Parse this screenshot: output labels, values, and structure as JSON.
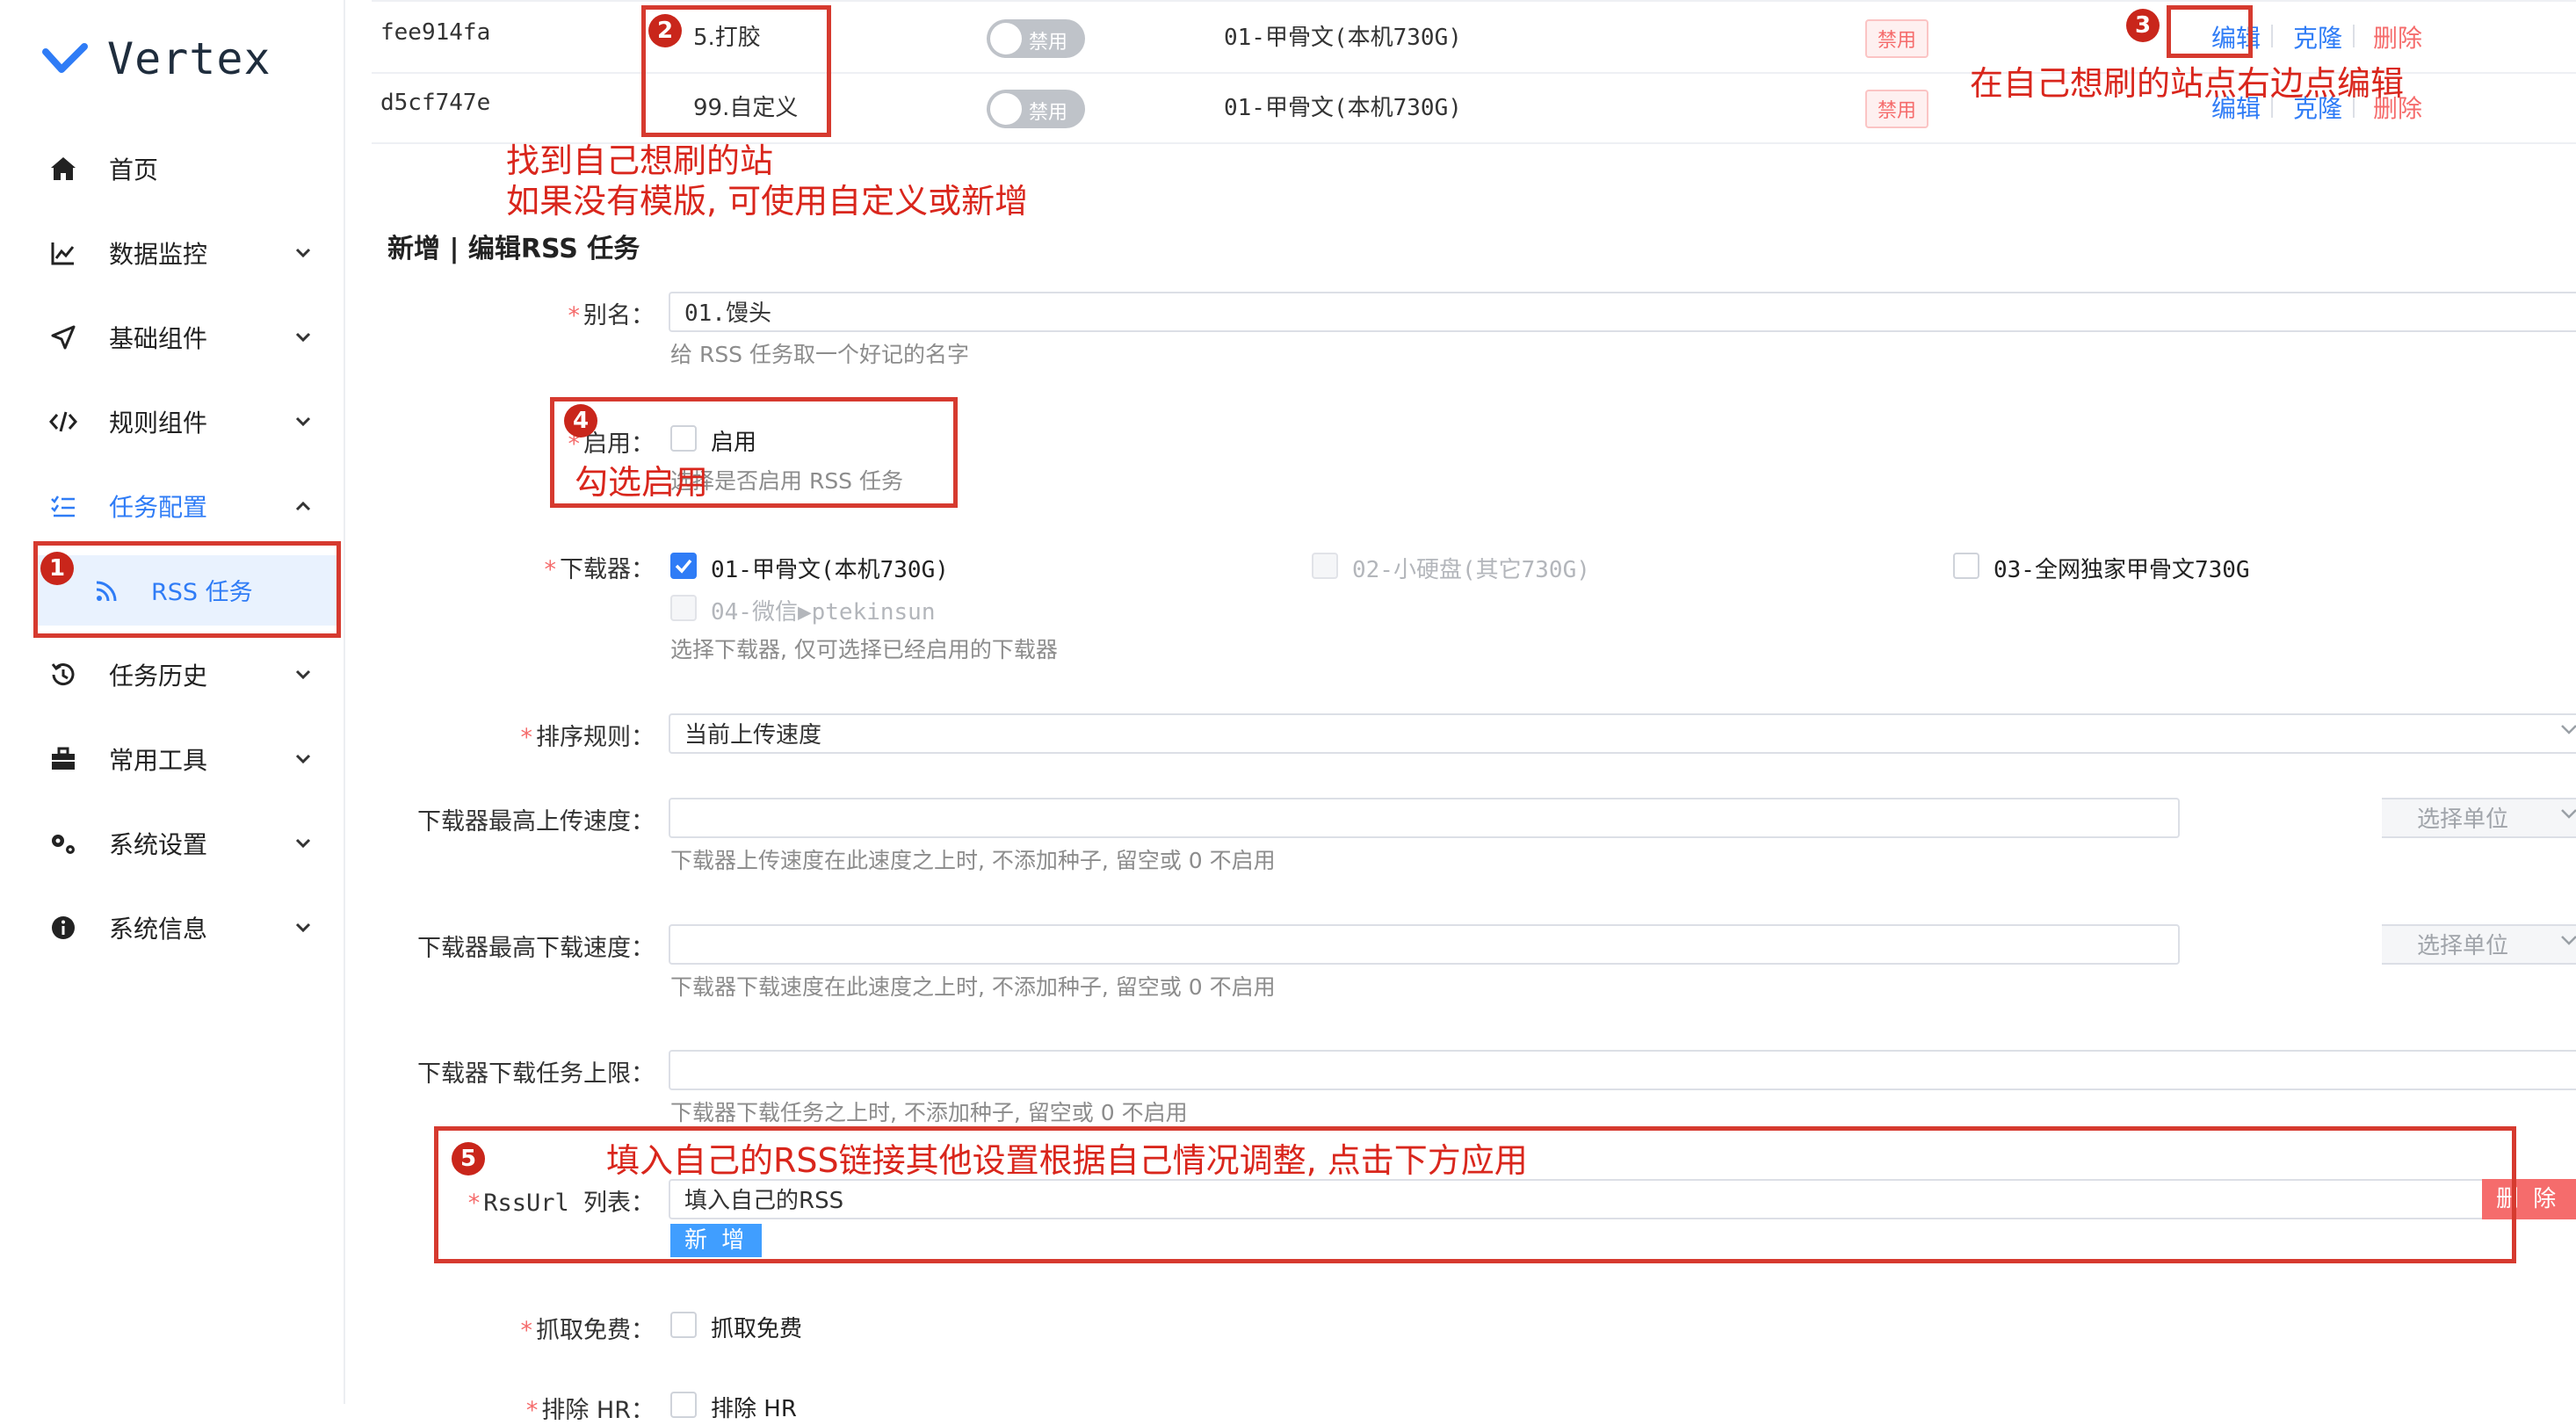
{
  "app": {
    "name": "Vertex"
  },
  "sidebar": {
    "items": [
      {
        "label": "首页",
        "icon": "home-icon"
      },
      {
        "label": "数据监控",
        "icon": "chart-line-icon"
      },
      {
        "label": "基础组件",
        "icon": "send-icon"
      },
      {
        "label": "规则组件",
        "icon": "code-icon"
      },
      {
        "label": "任务配置",
        "icon": "list-check-icon",
        "expanded": true
      },
      {
        "label": "任务历史",
        "icon": "history-icon"
      },
      {
        "label": "常用工具",
        "icon": "toolbox-icon"
      },
      {
        "label": "系统设置",
        "icon": "gears-icon"
      },
      {
        "label": "系统信息",
        "icon": "info-icon"
      }
    ],
    "sub_item": {
      "label": "RSS 任务",
      "icon": "rss-icon"
    }
  },
  "table": {
    "rows": [
      {
        "id": "fee914fa",
        "name": "5.打胶",
        "toggle": "禁用",
        "downloader": "01-甲骨文(本机730G)",
        "status": "禁用"
      },
      {
        "id": "d5cf747e",
        "name": "99.自定义",
        "toggle": "禁用",
        "downloader": "01-甲骨文(本机730G)",
        "status": "禁用"
      }
    ],
    "actions": {
      "edit": "编辑",
      "clone": "克隆",
      "delete": "删除"
    }
  },
  "form": {
    "title": "新增 | 编辑RSS 任务",
    "alias": {
      "label": "别名：",
      "value": "01.馒头",
      "help": "给 RSS 任务取一个好记的名字"
    },
    "enable": {
      "label": "启用：",
      "option": "启用",
      "help": "选择是否启用 RSS 任务"
    },
    "downloader": {
      "label": "下载器：",
      "options": [
        "01-甲骨文(本机730G)",
        "02-小硬盘(其它730G)",
        "03-全网独家甲骨文730G",
        "04-微信▶ptekinsun"
      ],
      "help": "选择下载器, 仅可选择已经启用的下载器"
    },
    "sort": {
      "label": "排序规则：",
      "value": "当前上传速度"
    },
    "max_upload": {
      "label": "下载器最高上传速度：",
      "unit": "选择单位",
      "help": "下载器上传速度在此速度之上时, 不添加种子, 留空或 0 不启用"
    },
    "max_download": {
      "label": "下载器最高下载速度：",
      "unit": "选择单位",
      "help": "下载器下载速度在此速度之上时, 不添加种子, 留空或 0 不启用"
    },
    "max_tasks": {
      "label": "下载器下载任务上限：",
      "help": "下载器下载任务之上时, 不添加种子, 留空或 0 不启用"
    },
    "rssurl": {
      "label": "RssUrl 列表：",
      "value": "填入自己的RSS",
      "add": "新 增",
      "delete": "删 除"
    },
    "free": {
      "label": "抓取免费：",
      "option": "抓取免费"
    },
    "exclude": {
      "label": "排除 HR：",
      "option": "排除 HR"
    }
  },
  "annotations": {
    "a1": "1",
    "a2": "2",
    "a2_text_1": "找到自己想刷的站",
    "a2_text_2": "如果没有模版, 可使用自定义或新增",
    "a3": "3",
    "a3_text": "在自己想刷的站点右边点编辑",
    "a4": "4",
    "a4_text": "勾选启用",
    "a5": "5",
    "a5_text": "填入自己的RSS链接其他设置根据自己情况调整, 点击下方应用"
  },
  "colors": {
    "accent": "#2f7cf6",
    "annotation": "#d63a2f",
    "danger": "#f56c6c"
  }
}
